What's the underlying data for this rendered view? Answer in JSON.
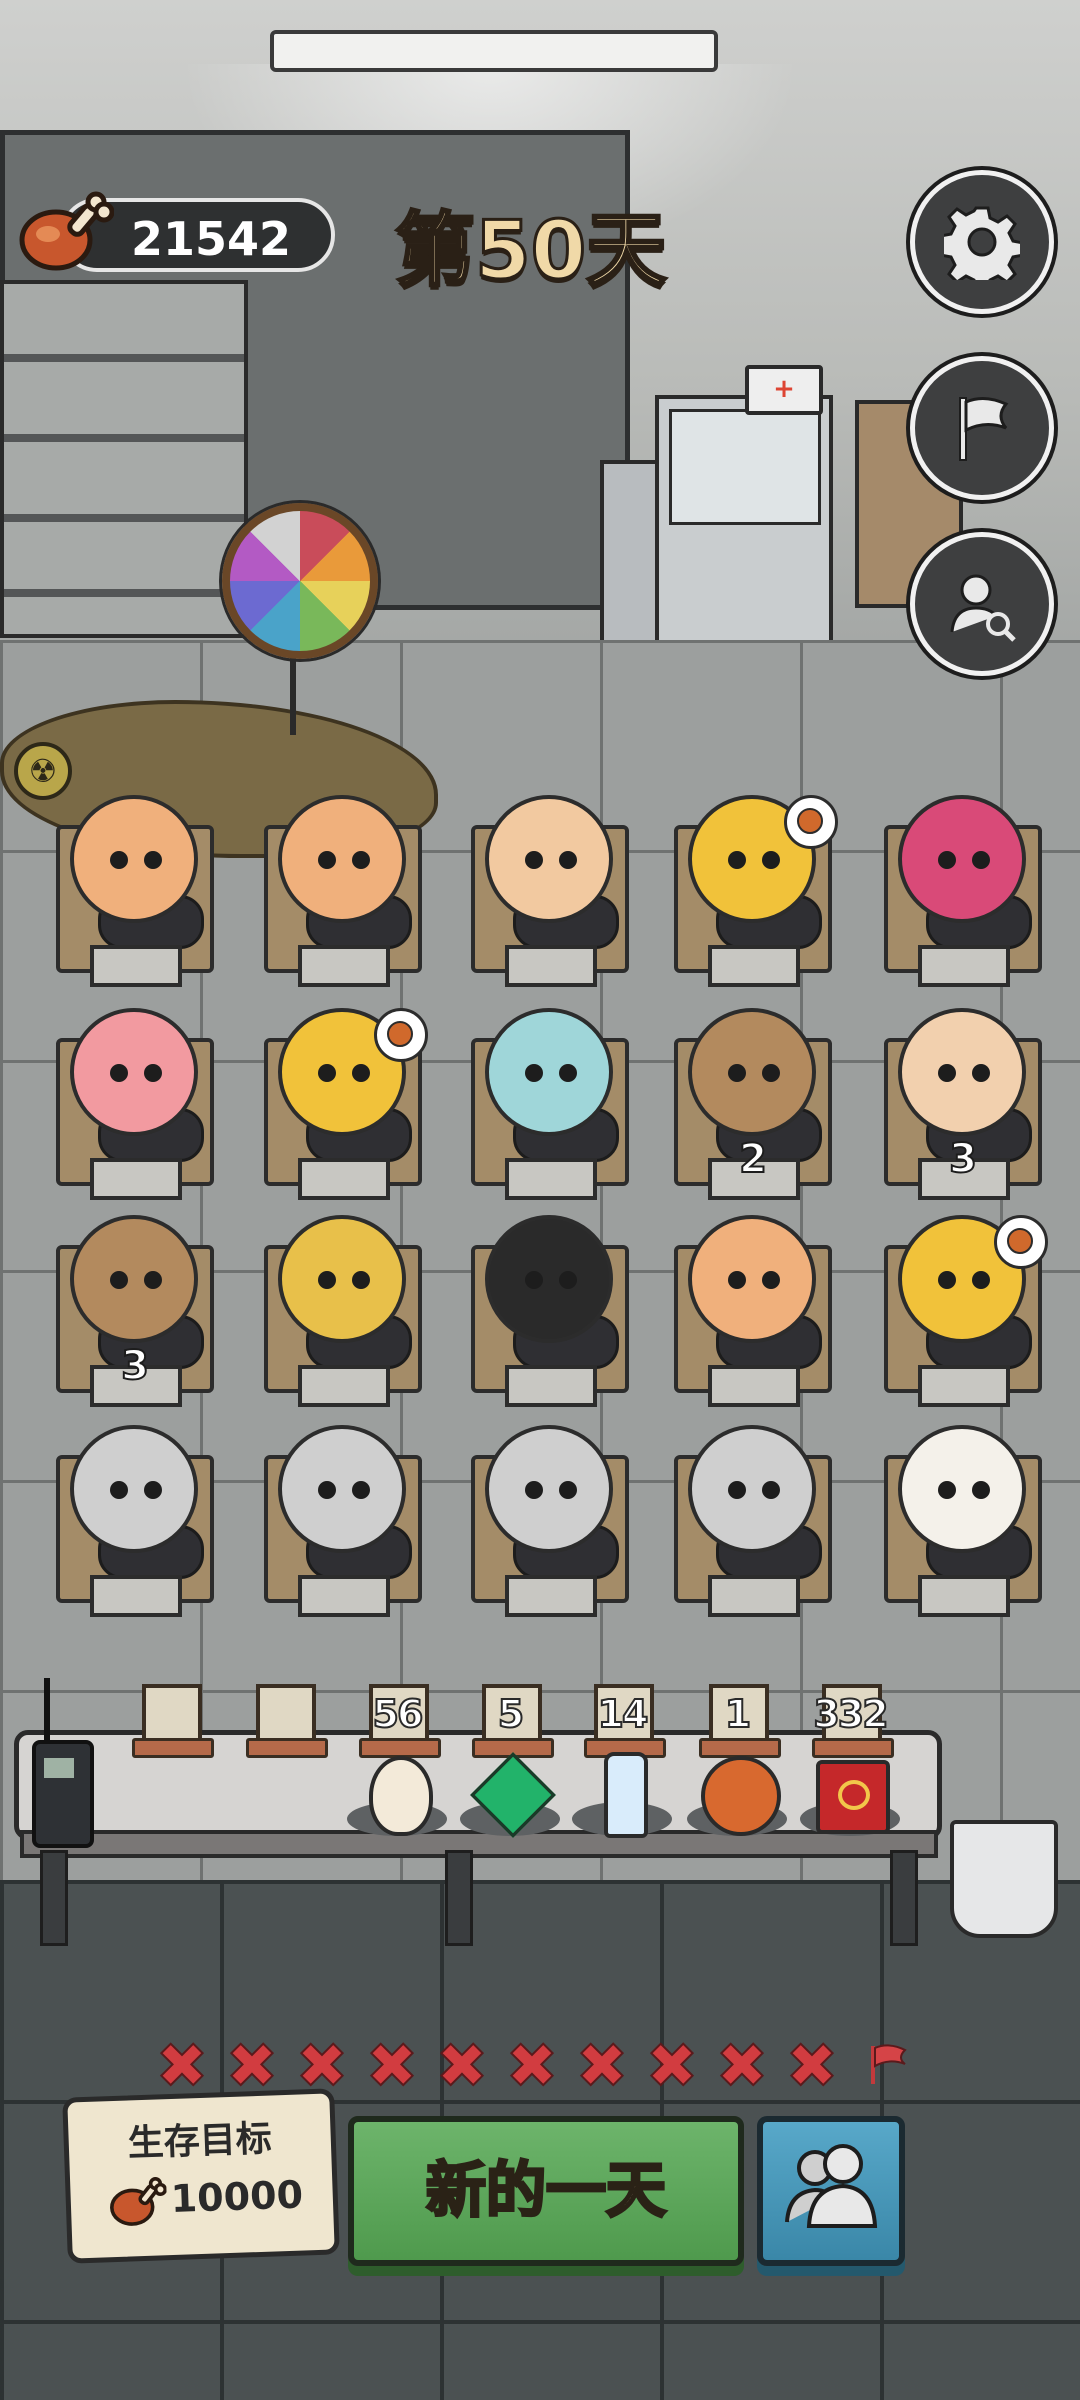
{
  "hud": {
    "meat_count": "21542",
    "day_label": "第50天",
    "buttons": [
      "gear-icon",
      "flag-icon",
      "player-search-icon"
    ]
  },
  "grid": {
    "rows": [
      [
        {
          "character": "orange-haired-girl",
          "count": ""
        },
        {
          "character": "orange-haired-girl",
          "count": ""
        },
        {
          "character": "basketball-boy",
          "count": ""
        },
        {
          "character": "grey-haired-duck",
          "count": "",
          "bubble": "basketball-icon"
        },
        {
          "character": "pink-curly-girl",
          "count": ""
        }
      ],
      [
        {
          "character": "pink-haired-girl",
          "count": ""
        },
        {
          "character": "grey-haired-duck",
          "count": "",
          "bubble": "basketball-icon"
        },
        {
          "character": "blue-cat",
          "count": ""
        },
        {
          "character": "eyepatch-girl",
          "count": "2"
        },
        {
          "character": "glasses-boy-reading",
          "count": "3"
        }
      ],
      [
        {
          "character": "eyepatch-girl",
          "count": "3"
        },
        {
          "character": "blonde-vampire",
          "count": ""
        },
        {
          "character": "sunglasses-boss",
          "count": ""
        },
        {
          "character": "orange-haired-girl",
          "count": ""
        },
        {
          "character": "grey-haired-duck",
          "count": "",
          "bubble": "basketball-icon"
        }
      ],
      [
        {
          "character": "bearded-miner",
          "count": ""
        },
        {
          "character": "bearded-miner",
          "count": ""
        },
        {
          "character": "bearded-miner",
          "count": ""
        },
        {
          "character": "bearded-miner",
          "count": ""
        },
        {
          "character": "sheikh",
          "count": ""
        }
      ]
    ]
  },
  "inventory": {
    "slots": [
      {
        "count": "",
        "item": ""
      },
      {
        "count": "",
        "item": ""
      },
      {
        "count": "56",
        "item": "egg-icon"
      },
      {
        "count": "5",
        "item": "emerald-icon"
      },
      {
        "count": "14",
        "item": "water-bottle-icon"
      },
      {
        "count": "1",
        "item": "basketball-icon"
      },
      {
        "count": "332",
        "item": "ring-box-icon"
      }
    ]
  },
  "progress": {
    "marks": [
      "✖",
      "✖",
      "✖",
      "✖",
      "✖",
      "✖",
      "✖",
      "✖",
      "✖",
      "✖"
    ],
    "end_icon": "red-flag-icon"
  },
  "goal": {
    "title": "生存目标",
    "value": "10000"
  },
  "actions": {
    "new_day_label": "新的一天",
    "people_icon": "people-icon"
  },
  "colors": {
    "accent_green": "#5aa857",
    "accent_blue": "#4a98b9",
    "mark_red": "#d23c40",
    "day_title": "#f0d9a8"
  }
}
